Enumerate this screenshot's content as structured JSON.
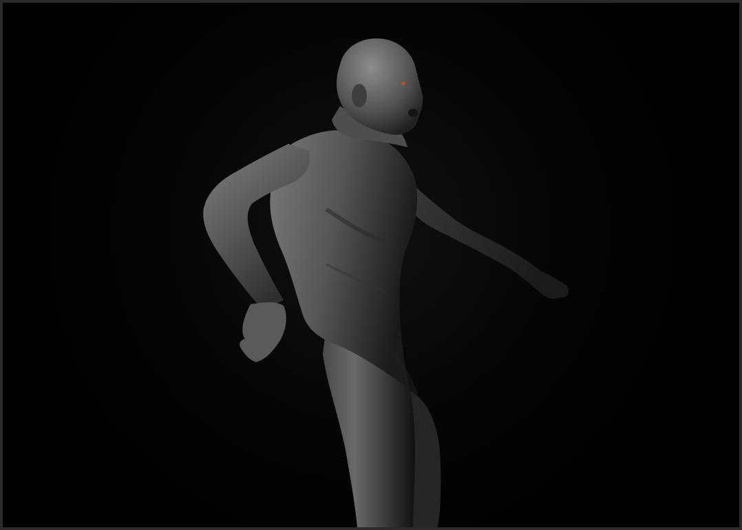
{
  "scene": {
    "background_color": "#000000",
    "frame_color": "#2b2b2b",
    "subject": "sculpt-render",
    "material_color": "#6e6e6e",
    "eye_accent_color": "#b0522a"
  }
}
